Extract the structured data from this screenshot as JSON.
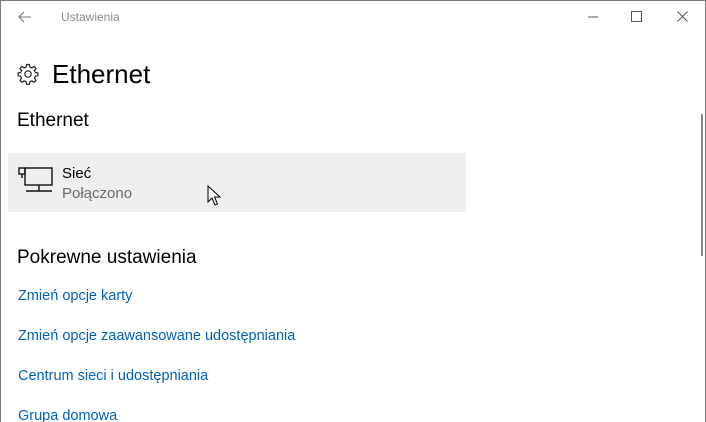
{
  "window": {
    "title": "Ustawienia"
  },
  "icons": {
    "back": "back-arrow-icon",
    "minimize": "minimize-icon",
    "maximize": "maximize-icon",
    "close": "close-icon",
    "settings": "gear-icon",
    "network": "ethernet-network-icon",
    "cursor": "mouse-pointer-icon"
  },
  "page": {
    "title": "Ethernet"
  },
  "ethernet_section": {
    "title": "Ethernet",
    "network": {
      "name": "Sieć",
      "status": "Połączono"
    }
  },
  "related_section": {
    "title": "Pokrewne ustawienia",
    "links": [
      {
        "label": "Zmień opcje karty"
      },
      {
        "label": "Zmień opcje zaawansowane udostępniania"
      },
      {
        "label": "Centrum sieci i udostępniania"
      },
      {
        "label": "Grupa domowa"
      }
    ]
  },
  "colors": {
    "link": "#0063b1",
    "tile_background": "#efefef",
    "secondary_text": "#6b6b6b",
    "title_text": "#8a8a8a"
  }
}
